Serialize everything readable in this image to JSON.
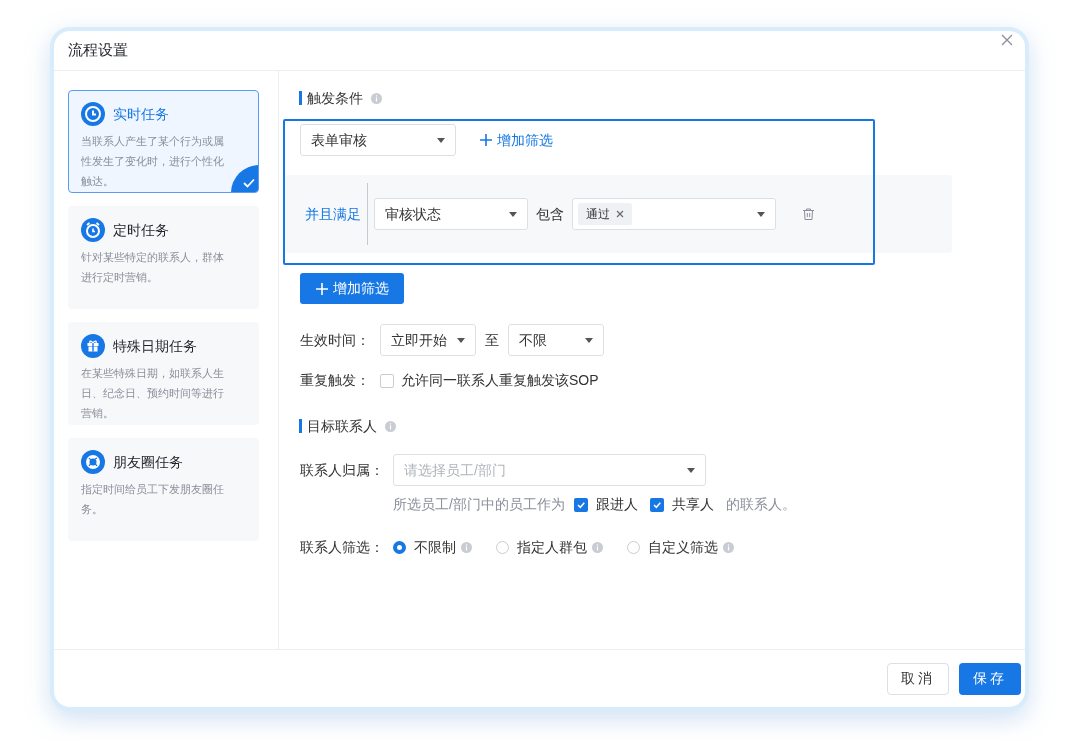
{
  "dialog": {
    "title": "流程设置"
  },
  "task_types": [
    {
      "kind": "realtime",
      "title": "实时任务",
      "description": "当联系人产生了某个行为或属性发生了变化时，进行个性化触达。",
      "selected": true
    },
    {
      "kind": "scheduled",
      "title": "定时任务",
      "description": "针对某些特定的联系人，群体进行定时营销。",
      "selected": false
    },
    {
      "kind": "special_date",
      "title": "特殊日期任务",
      "description": "在某些特殊日期，如联系人生日、纪念日、预约时间等进行营销。",
      "selected": false
    },
    {
      "kind": "moments",
      "title": "朋友圈任务",
      "description": "指定时间给员工下发朋友圈任务。",
      "selected": false
    }
  ],
  "trigger": {
    "title": "触发条件",
    "highlighted": true,
    "event_select": "表单审核",
    "add_filter_link": "增加筛选",
    "condition": {
      "logic": "并且满足",
      "field": "审核状态",
      "operator": "包含",
      "tags": [
        {
          "label": "通过"
        }
      ]
    },
    "add_filter_button": "增加筛选"
  },
  "effective_time": {
    "label": "生效时间：",
    "start": "立即开始",
    "separator": "至",
    "end": "不限"
  },
  "repeat": {
    "label": "重复触发：",
    "option": "允许同一联系人重复触发该SOP",
    "checked": false
  },
  "target": {
    "title": "目标联系人",
    "owner": {
      "label": "联系人归属：",
      "placeholder": "请选择员工/部门"
    },
    "role_prefix": "所选员工/部门中的员工作为",
    "roles": [
      {
        "label": "跟进人",
        "checked": true
      },
      {
        "label": "共享人",
        "checked": true
      }
    ],
    "role_suffix": "的联系人。",
    "filter": {
      "label": "联系人筛选：",
      "options": [
        {
          "label": "不限制",
          "selected": true
        },
        {
          "label": "指定人群包",
          "selected": false
        },
        {
          "label": "自定义筛选",
          "selected": false
        }
      ]
    }
  },
  "footer": {
    "cancel": "取消",
    "save": "保存"
  }
}
